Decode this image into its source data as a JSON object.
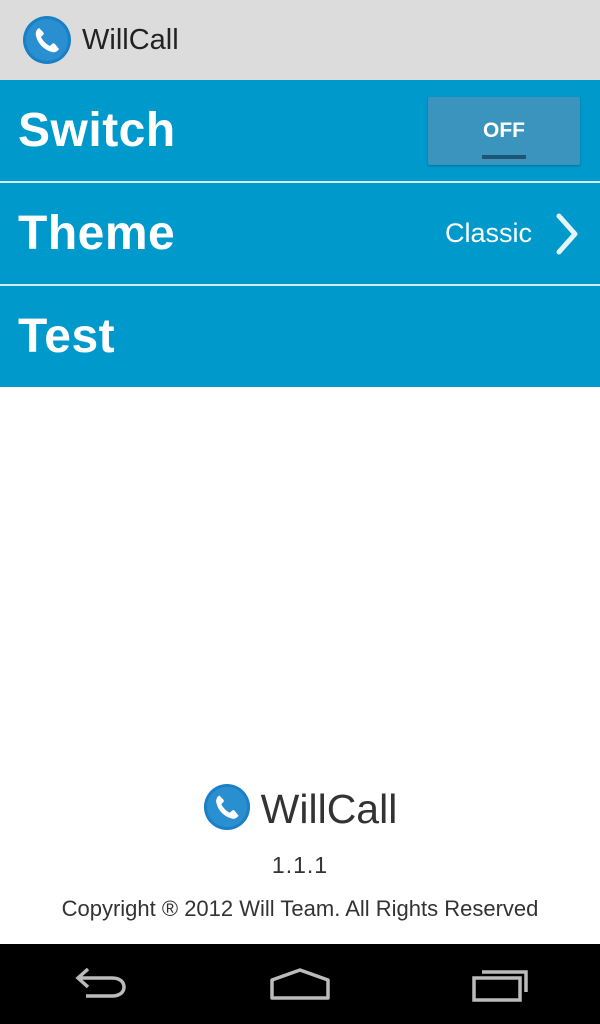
{
  "app": {
    "title": "WillCall",
    "icon": "phone-icon"
  },
  "settings": {
    "switch_label": "Switch",
    "switch_state": "OFF",
    "theme_label": "Theme",
    "theme_value": "Classic",
    "test_label": "Test"
  },
  "footer": {
    "title": "WillCall",
    "version": "1.1.1",
    "copyright": "Copyright ® 2012 Will Team. All Rights Reserved"
  },
  "colors": {
    "accent": "#0099cc",
    "actionbar": "#dcdcdc",
    "icon_blue": "#1a7fc4",
    "navbar": "#000000"
  },
  "navbar": {
    "icons": [
      "back-icon",
      "home-icon",
      "recent-apps-icon"
    ]
  }
}
